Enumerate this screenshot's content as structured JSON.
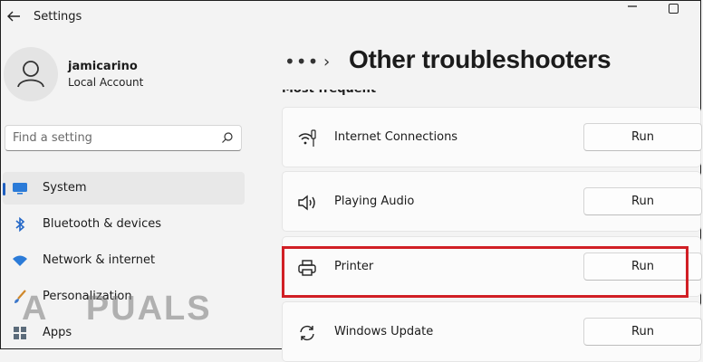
{
  "window": {
    "title": "Settings"
  },
  "user": {
    "name": "jamicarino",
    "account": "Local Account"
  },
  "search": {
    "placeholder": "Find a setting"
  },
  "nav": [
    {
      "label": "System",
      "icon": "monitor-icon",
      "active": true
    },
    {
      "label": "Bluetooth & devices",
      "icon": "bluetooth-icon"
    },
    {
      "label": "Network & internet",
      "icon": "wifi-icon"
    },
    {
      "label": "Personalization",
      "icon": "paintbrush-icon"
    },
    {
      "label": "Apps",
      "icon": "apps-icon"
    }
  ],
  "breadcrumb": {
    "ellipsis": "•••",
    "chevron": "›"
  },
  "page": {
    "title": "Other troubleshooters",
    "section": "Most frequent"
  },
  "troubleshooters": [
    {
      "label": "Internet Connections",
      "icon": "network-icon",
      "button": "Run"
    },
    {
      "label": "Playing Audio",
      "icon": "speaker-icon",
      "button": "Run"
    },
    {
      "label": "Printer",
      "icon": "printer-icon",
      "button": "Run",
      "highlighted": true
    },
    {
      "label": "Windows Update",
      "icon": "refresh-icon",
      "button": "Run"
    }
  ],
  "watermark": {
    "text": "A PUALS"
  },
  "colors": {
    "accent": "#1f5fbf",
    "highlight": "#d11f25"
  }
}
